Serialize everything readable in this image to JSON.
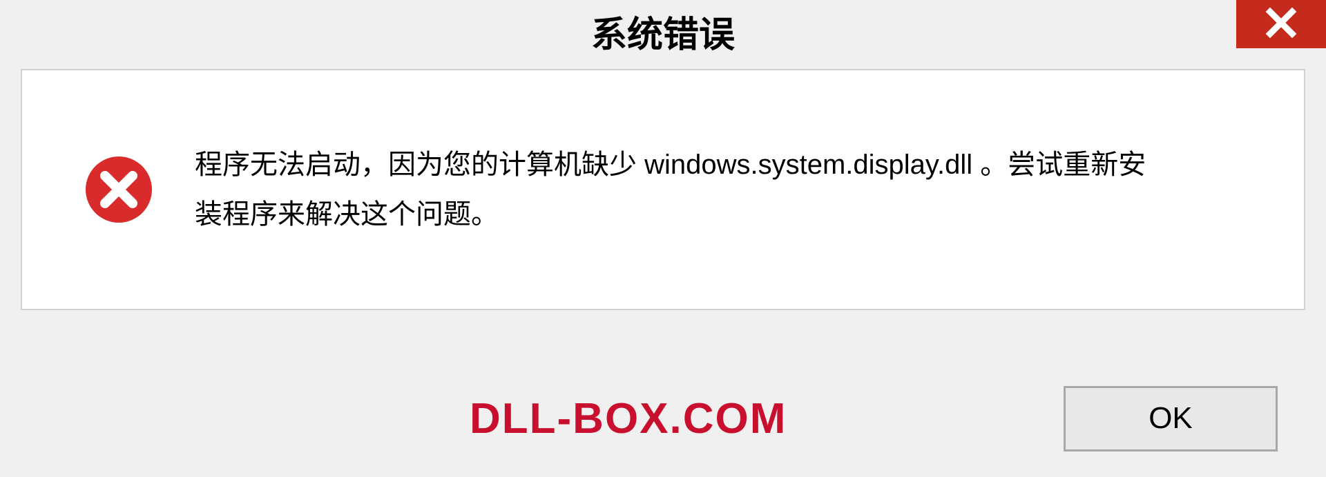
{
  "dialog": {
    "title": "系统错误",
    "message": "程序无法启动，因为您的计算机缺少 windows.system.display.dll 。尝试重新安装程序来解决这个问题。"
  },
  "buttons": {
    "ok_label": "OK"
  },
  "watermark": {
    "text": "DLL-BOX.COM"
  },
  "colors": {
    "close_bg": "#c42b1c",
    "error_icon": "#d92b2b",
    "watermark": "#c8102e"
  }
}
